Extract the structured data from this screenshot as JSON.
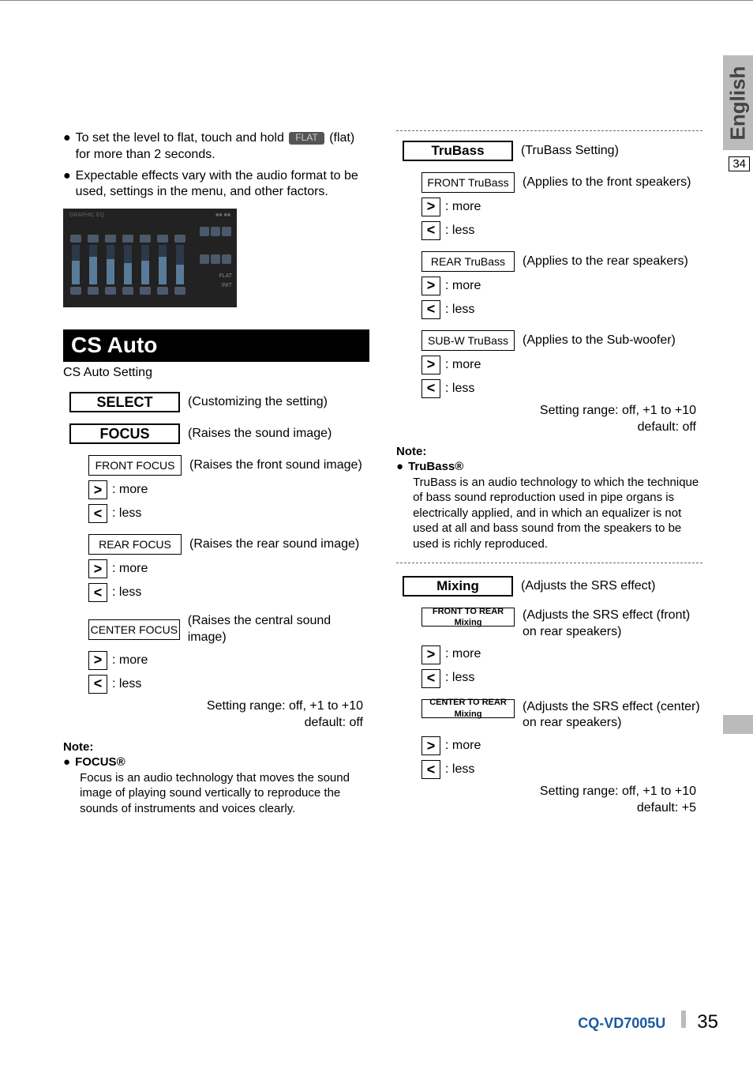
{
  "sideTab": {
    "label": "English",
    "pageRef": "34"
  },
  "left": {
    "bullet1_a": "To set the level to flat, touch and hold",
    "flatBtn": "FLAT",
    "bullet1_b": "(flat) for more than 2 seconds.",
    "bullet2": "Expectable effects vary with the audio format to be used, settings in the menu, and other factors.",
    "csAuto": {
      "title": "CS Auto",
      "subtitle": "CS Auto Setting",
      "select": {
        "label": "SELECT",
        "desc": "(Customizing the setting)"
      },
      "focus": {
        "label": "FOCUS",
        "desc": "(Raises the sound image)",
        "front": {
          "label": "FRONT FOCUS",
          "desc": "(Raises the front sound image)",
          "more": ": more",
          "less": ": less"
        },
        "rear": {
          "label": "REAR FOCUS",
          "desc": "(Raises the rear sound image)",
          "more": ": more",
          "less": ": less"
        },
        "center": {
          "label": "CENTER FOCUS",
          "desc": "(Raises the central sound image)",
          "more": ": more",
          "less": ": less"
        },
        "range": "Setting range: off, +1 to +10",
        "default": "default: off"
      },
      "note": {
        "title": "Note:",
        "heading": "FOCUS®",
        "body": "Focus is an audio technology that moves the sound image of playing sound vertically to reproduce the sounds of instruments and voices clearly."
      }
    }
  },
  "right": {
    "trubass": {
      "label": "TruBass",
      "desc": "(TruBass Setting)",
      "front": {
        "label": "FRONT TruBass",
        "desc": "(Applies to the front speakers)",
        "more": ": more",
        "less": ": less"
      },
      "rear": {
        "label": "REAR TruBass",
        "desc": "(Applies to the rear speakers)",
        "more": ": more",
        "less": ": less"
      },
      "subw": {
        "label": "SUB-W TruBass",
        "desc": "(Applies to the Sub-woofer)",
        "more": ": more",
        "less": ": less"
      },
      "range": "Setting range: off, +1 to +10",
      "default": "default: off",
      "note": {
        "title": "Note:",
        "heading": "TruBass®",
        "body": "TruBass is an audio technology to which the technique of bass sound reproduction used in pipe organs is electrically applied, and in which an equalizer is not used at all and bass sound from the speakers to be used is richly reproduced."
      }
    },
    "mixing": {
      "label": "Mixing",
      "desc": "(Adjusts the SRS effect)",
      "front": {
        "label": "FRONT TO REAR Mixing",
        "desc1": "(Adjusts the SRS effect (front)",
        "desc2": "on rear speakers)",
        "more": ": more",
        "less": ": less"
      },
      "center": {
        "label": "CENTER TO REAR Mixing",
        "desc1": "(Adjusts the SRS effect (center)",
        "desc2": "on rear speakers)",
        "more": ": more",
        "less": ": less"
      },
      "range": "Setting range: off, +1 to +10",
      "default": "default: +5"
    }
  },
  "footer": {
    "model": "CQ-VD7005U",
    "page": "35"
  }
}
